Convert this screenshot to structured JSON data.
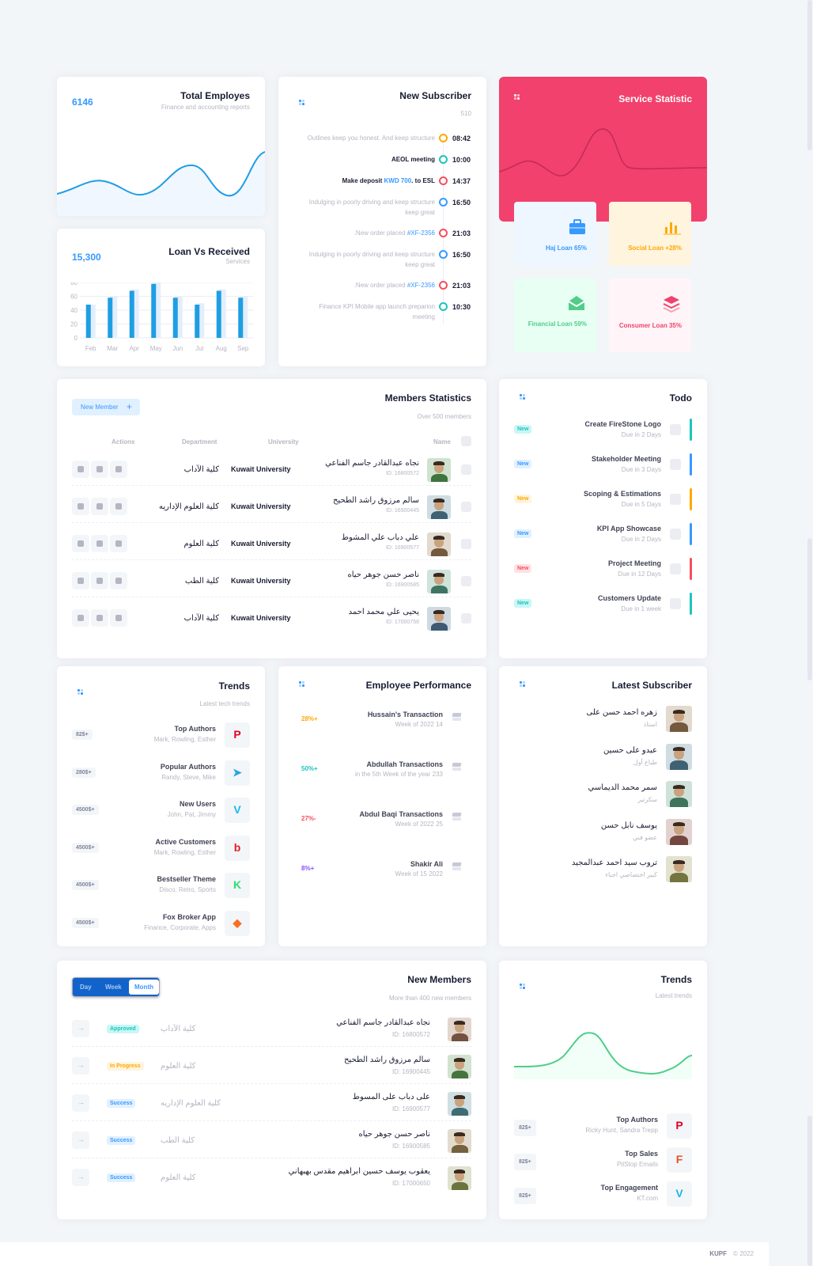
{
  "total_employes": {
    "title": "Total Employes",
    "subtitle": "Finance and accounting reports",
    "value": "6146"
  },
  "loan_vs_received": {
    "title": "Loan Vs Received",
    "subtitle": "Services",
    "value": "15,300"
  },
  "chart_data": {
    "type": "bar",
    "categories": [
      "Feb",
      "Mar",
      "Apr",
      "May",
      "Jun",
      "Jul",
      "Aug",
      "Sep"
    ],
    "series": [
      {
        "values": [
          48,
          58,
          68,
          78,
          58,
          48,
          68,
          58
        ]
      },
      {
        "values": [
          48,
          60,
          70,
          80,
          60,
          50,
          70,
          60
        ]
      }
    ],
    "yticks": [
      "80",
      "60",
      "40",
      "20",
      "0"
    ],
    "ylim": [
      0,
      80
    ]
  },
  "new_subscriber": {
    "title": "New Subscriber",
    "count": "510",
    "items": [
      {
        "text": "Outlines keep you honest. And keep structure",
        "time": "08:42",
        "color": "#ffa800",
        "bold": false
      },
      {
        "text": "AEOL meeting",
        "time": "10:00",
        "color": "#1bc5bd",
        "bold": true
      },
      {
        "text_pre": "Make deposit ",
        "link": "KWD 700",
        "text_post": ". to ESL",
        "time": "14:37",
        "color": "#f64e60",
        "bold": true
      },
      {
        "text": "Indulging in poorly driving and keep structure keep great",
        "time": "16:50",
        "color": "#3699ff",
        "bold": false
      },
      {
        "text_pre": ".New order placed ",
        "link": "#XF-2356",
        "text_post": "",
        "time": "21:03",
        "color": "#f64e60",
        "bold": false
      },
      {
        "text": "Indulging in poorly driving and keep structure keep great",
        "time": "16:50",
        "color": "#3699ff",
        "bold": false
      },
      {
        "text_pre": ".New order placed ",
        "link": "#XF-2356",
        "text_post": "",
        "time": "21:03",
        "color": "#f64e60",
        "bold": false
      },
      {
        "text": "Finance KPI Mobile app launch preparion meeting",
        "time": "10:30",
        "color": "#1bc5bd",
        "bold": false
      }
    ]
  },
  "service_statistic": {
    "title": "Service Statistic",
    "tiles": [
      {
        "label": "Haj Loan 65%",
        "icon": "briefcase-icon"
      },
      {
        "label": "Social Loan +28%",
        "icon": "bar-chart-icon"
      },
      {
        "label": "Financial Loan 59%",
        "icon": "envelope-icon"
      },
      {
        "label": "Consumer Loan 35%",
        "icon": "layers-icon"
      }
    ]
  },
  "members_statistics": {
    "title": "Members Statistics",
    "subtitle": "Over 500 members",
    "new_member": "New Member",
    "headers": {
      "actions": "Actions",
      "department": "Department",
      "university": "University",
      "name": "Name"
    },
    "rows": [
      {
        "name": "نجاه عبدالقادر جاسم الفناعي",
        "id": "ID: 16800572",
        "university": "Kuwait University",
        "department": "كلية الآداب"
      },
      {
        "name": "سالم مرزوق راشد الطحيح",
        "id": "ID: 16900445",
        "university": "Kuwait University",
        "department": "كلية العلوم الإداريه"
      },
      {
        "name": "علي دباب علي المشوط",
        "id": "ID: 16900577",
        "university": "Kuwait University",
        "department": "كلية العلوم"
      },
      {
        "name": "ناصر حسن جوهر حياه",
        "id": "ID: 16900585",
        "university": "Kuwait University",
        "department": "كلية الطب"
      },
      {
        "name": "يحيى علي محمد احمد",
        "id": "ID: 17000758",
        "university": "Kuwait University",
        "department": "كلية الآداب"
      }
    ]
  },
  "todo": {
    "title": "Todo",
    "items": [
      {
        "title": "Create FireStone Logo",
        "due": "Due in 2 Days",
        "badge": "New",
        "color": "#1bc5bd",
        "bg": "#c9f7f5"
      },
      {
        "title": "Stakeholder Meeting",
        "due": "Due in 3 Days",
        "badge": "New",
        "color": "#3699ff",
        "bg": "#e1f0ff"
      },
      {
        "title": "Scoping & Estimations",
        "due": "Due in 5 Days",
        "badge": "New",
        "color": "#ffa800",
        "bg": "#fff4de"
      },
      {
        "title": "KPI App Showcase",
        "due": "Due in 2 Days",
        "badge": "New",
        "color": "#3699ff",
        "bg": "#e1f0ff"
      },
      {
        "title": "Project Meeting",
        "due": "Due in 12 Days",
        "badge": "New",
        "color": "#f64e60",
        "bg": "#ffe2e5"
      },
      {
        "title": "Customers Update",
        "due": "Due in 1 week",
        "badge": "New",
        "color": "#1bc5bd",
        "bg": "#c9f7f5"
      }
    ]
  },
  "trends": {
    "title": "Trends",
    "subtitle": "Latest tech trends",
    "items": [
      {
        "title": "Top Authors",
        "sub": "Mark, Rowling, Esther",
        "price": "82$+",
        "icon": "pinterest-icon"
      },
      {
        "title": "Popular Authors",
        "sub": "Randy, Steve, Mike",
        "price": "280$+",
        "icon": "telegram-icon"
      },
      {
        "title": "New Users",
        "sub": "John, Pat, Jimmy",
        "price": "4500$+",
        "icon": "vimeo-icon"
      },
      {
        "title": "Active Customers",
        "sub": "Mark, Rowling, Esther",
        "price": "4500$+",
        "icon": "bebo-icon"
      },
      {
        "title": "Bestseller Theme",
        "sub": "Disco, Retro, Sports",
        "price": "4500$+",
        "icon": "kickstarter-icon"
      },
      {
        "title": "Fox Broker App",
        "sub": "Finance, Corporate, Apps",
        "price": "4500$+",
        "icon": "gitlab-icon"
      }
    ]
  },
  "employee_performance": {
    "title": "Employee Performance",
    "items": [
      {
        "title": "Hussain's Transaction",
        "sub": "Week of 2022 14",
        "pct": "28%+",
        "color": "#ffa800"
      },
      {
        "title": "Abdullah Transactions",
        "sub": "in the 5th Week of the year 233",
        "pct": "50%+",
        "color": "#1bc5bd"
      },
      {
        "title": "Abdul Baqi Transactions",
        "sub": "Week of 2022 25",
        "pct": "27%-",
        "color": "#f64e60"
      },
      {
        "title": "Shakir Ali",
        "sub": "Week of 15 2022",
        "pct": "8%+",
        "color": "#8950fc"
      }
    ]
  },
  "latest_subscriber": {
    "title": "Latest Subscriber",
    "items": [
      {
        "name": "زهره احمد حسن على",
        "role": "استاذ"
      },
      {
        "name": "عبدو على حسين",
        "role": "طباع أول"
      },
      {
        "name": "سمر محمد الديماسي",
        "role": "سكرتير"
      },
      {
        "name": "يوسف نابل حسن",
        "role": "عضو فني"
      },
      {
        "name": "تروب سيد احمد عبدالمجيد",
        "role": "كبير اختصاصي اجباء"
      }
    ]
  },
  "new_members": {
    "title": "New Members",
    "subtitle": "More than 400 new members",
    "tabs": [
      "Day",
      "Week",
      "Month"
    ],
    "rows": [
      {
        "name": "نجاه عبدالقادر جاسم الفناعي",
        "id": "ID: 16800572",
        "department": "كلية الآداب",
        "status": "Approved",
        "color": "#1bc5bd",
        "bg": "#c9f7f5"
      },
      {
        "name": "سالم مرزوق راشد الطحيح",
        "id": "ID: 16900445",
        "department": "كلية العلوم",
        "status": "In Progress",
        "color": "#ffa800",
        "bg": "#fff4de"
      },
      {
        "name": "على دباب على المسوط",
        "id": "ID: 16900577",
        "department": "كلية العلوم الإداريه",
        "status": "Success",
        "color": "#3699ff",
        "bg": "#e1f0ff"
      },
      {
        "name": "ناصر حسن جوهر حياه",
        "id": "ID: 16900585",
        "department": "كلية الطب",
        "status": "Success",
        "color": "#3699ff",
        "bg": "#e1f0ff"
      },
      {
        "name": "يعقوب يوسف حسين ابراهيم مقدس بهبهاني",
        "id": "ID: 17000650",
        "department": "كلية العلوم",
        "status": "Success",
        "color": "#3699ff",
        "bg": "#e1f0ff"
      }
    ]
  },
  "trends2": {
    "title": "Trends",
    "subtitle": "Latest trends",
    "items": [
      {
        "title": "Top Authors",
        "sub": "Ricky Hunt, Sandra Trepp",
        "price": "82$+",
        "icon": "pinterest-icon"
      },
      {
        "title": "Top Sales",
        "sub": "PitStop Emails",
        "price": "82$+",
        "icon": "figma-icon"
      },
      {
        "title": "Top Engagement",
        "sub": "KT.com",
        "price": "82$+",
        "icon": "vimeo-icon"
      }
    ]
  },
  "footer": {
    "brand": "KUPF",
    "copy": "© 2022"
  }
}
